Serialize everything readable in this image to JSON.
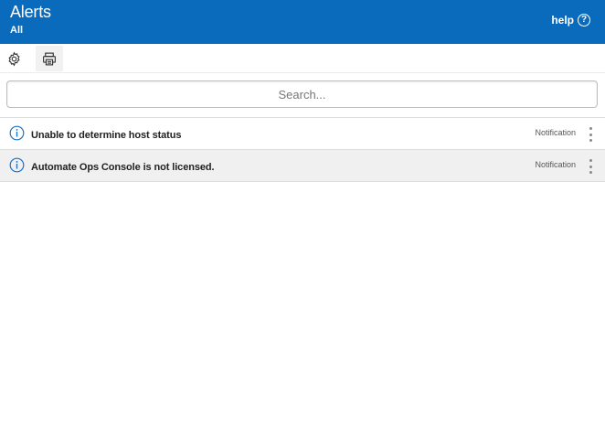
{
  "header": {
    "title": "Alerts",
    "subtitle": "All",
    "help_label": "help",
    "help_icon": "?",
    "background_color": "#0a6bbd"
  },
  "toolbar": {
    "buttons": [
      {
        "name": "settings",
        "icon": "gear-icon"
      },
      {
        "name": "print",
        "icon": "printer-icon"
      }
    ]
  },
  "search": {
    "placeholder": "Search...",
    "value": ""
  },
  "alerts": [
    {
      "icon": "info-icon",
      "message": "Unable to determine host status",
      "type": "Notification"
    },
    {
      "icon": "info-icon",
      "message": "Automate Ops Console is not licensed.",
      "type": "Notification"
    }
  ],
  "colors": {
    "accent": "#0a6bbd",
    "info_icon": "#1a73c8"
  }
}
